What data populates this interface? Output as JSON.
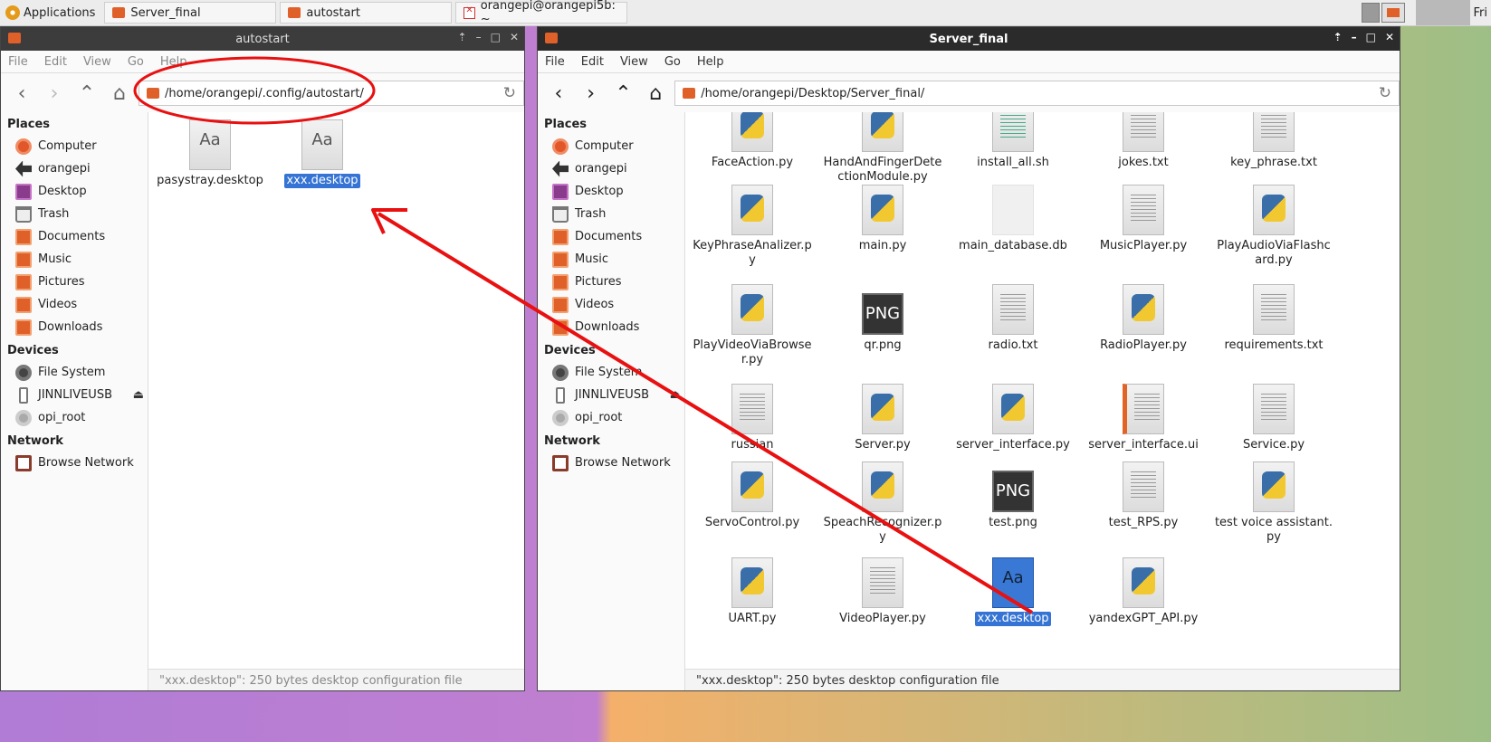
{
  "panel": {
    "apps_label": "Applications",
    "tasks": [
      "Server_final",
      "autostart",
      "orangepi@orangepi5b: ~"
    ],
    "day": "Fri"
  },
  "left_window": {
    "title": "autostart",
    "menu": [
      "File",
      "Edit",
      "View",
      "Go",
      "Help"
    ],
    "path": "/home/orangepi/.config/autostart/",
    "files": [
      {
        "name": "pasystray.desktop",
        "icon": "font-icon"
      },
      {
        "name": "xxx.desktop",
        "icon": "font-icon",
        "selected": true
      }
    ],
    "status": "\"xxx.desktop\": 250 bytes desktop configuration file"
  },
  "right_window": {
    "title": "Server_final",
    "menu": [
      "File",
      "Edit",
      "View",
      "Go",
      "Help"
    ],
    "path": "/home/orangepi/Desktop/Server_final/",
    "files": [
      {
        "name": "FaceAction.py",
        "icon": "python-icon"
      },
      {
        "name": "HandAndFingerDetectionModule.py",
        "icon": "python-icon"
      },
      {
        "name": "install_all.sh",
        "icon": "script-icon"
      },
      {
        "name": "jokes.txt",
        "icon": "text-icon"
      },
      {
        "name": "key_phrase.txt",
        "icon": "text-icon"
      },
      {
        "name": "KeyPhraseAnalizer.py",
        "icon": "python-icon"
      },
      {
        "name": "main.py",
        "icon": "python-icon"
      },
      {
        "name": "main_database.db",
        "icon": "blank-icon"
      },
      {
        "name": "MusicPlayer.py",
        "icon": "text-icon"
      },
      {
        "name": "PlayAudioViaFlashcard.py",
        "icon": "python-icon"
      },
      {
        "name": "PlayVideoViaBrowser.py",
        "icon": "python-icon"
      },
      {
        "name": "qr.png",
        "icon": "png-icon"
      },
      {
        "name": "radio.txt",
        "icon": "text-icon"
      },
      {
        "name": "RadioPlayer.py",
        "icon": "python-icon"
      },
      {
        "name": "requirements.txt",
        "icon": "text-icon"
      },
      {
        "name": "russian",
        "icon": "text-icon"
      },
      {
        "name": "Server.py",
        "icon": "python-icon"
      },
      {
        "name": "server_interface.py",
        "icon": "python-icon"
      },
      {
        "name": "server_interface.ui",
        "icon": "ui-icon"
      },
      {
        "name": "Service.py",
        "icon": "text-icon"
      },
      {
        "name": "ServoControl.py",
        "icon": "python-icon"
      },
      {
        "name": "SpeachRecognizer.py",
        "icon": "python-icon"
      },
      {
        "name": "test.png",
        "icon": "png-icon"
      },
      {
        "name": "test_RPS.py",
        "icon": "text-icon"
      },
      {
        "name": "test voice assistant.py",
        "icon": "python-icon"
      },
      {
        "name": "UART.py",
        "icon": "python-icon"
      },
      {
        "name": "VideoPlayer.py",
        "icon": "text-icon"
      },
      {
        "name": "xxx.desktop",
        "icon": "font-icon",
        "selected": true
      },
      {
        "name": "yandexGPT_API.py",
        "icon": "python-icon"
      }
    ],
    "status": "\"xxx.desktop\": 250 bytes desktop configuration file"
  },
  "sidebar": {
    "places_header": "Places",
    "places": [
      {
        "label": "Computer",
        "icon": "computer-icon"
      },
      {
        "label": "orangepi",
        "icon": "home-icon"
      },
      {
        "label": "Desktop",
        "icon": "desktop-icon"
      },
      {
        "label": "Trash",
        "icon": "trash-icon"
      },
      {
        "label": "Documents",
        "icon": "folder-icon"
      },
      {
        "label": "Music",
        "icon": "folder-icon"
      },
      {
        "label": "Pictures",
        "icon": "folder-icon"
      },
      {
        "label": "Videos",
        "icon": "folder-icon"
      },
      {
        "label": "Downloads",
        "icon": "folder-icon"
      }
    ],
    "devices_header": "Devices",
    "devices": [
      {
        "label": "File System",
        "icon": "disk-icon"
      },
      {
        "label": "JINNLIVEUSB",
        "icon": "usb-icon"
      },
      {
        "label": "opi_root",
        "icon": "disk-icon"
      }
    ],
    "network_header": "Network",
    "network": [
      {
        "label": "Browse Network",
        "icon": "network-icon"
      }
    ]
  },
  "colors": {
    "selection": "#3574d4",
    "annotation": "#e81010",
    "folder": "#e0602a"
  }
}
